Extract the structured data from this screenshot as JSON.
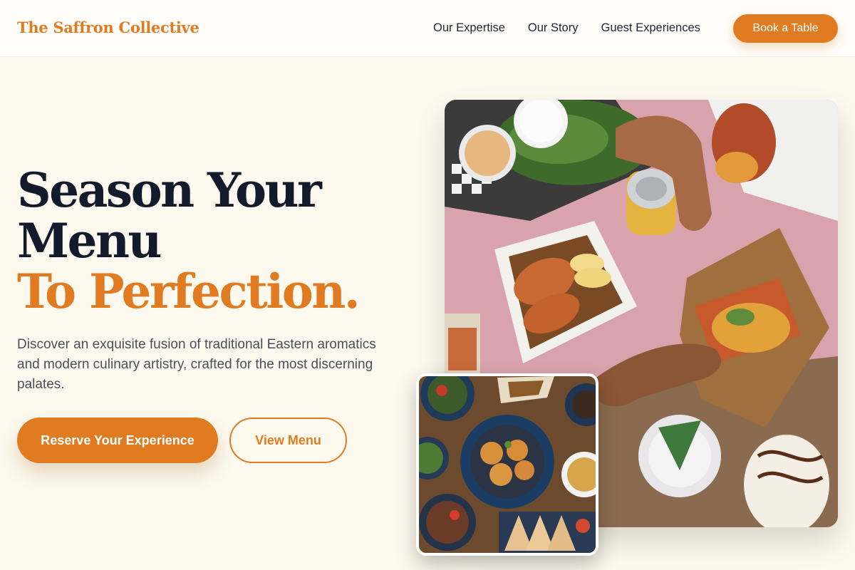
{
  "brand": {
    "name": "The Saffron Collective"
  },
  "nav": {
    "links": [
      "Our Expertise",
      "Our Story",
      "Guest Experiences"
    ],
    "cta": "Book a Table"
  },
  "hero": {
    "headline_line1": "Season Your",
    "headline_line2": "Menu",
    "headline_accent": "To Perfection.",
    "subtext": "Discover an exquisite fusion of traditional Eastern aromatics and modern culinary artistry, crafted for the most discerning palates.",
    "primary_cta": "Reserve Your Experience",
    "secondary_cta": "View Menu"
  },
  "colors": {
    "accent": "#e07b21",
    "background": "#fdf9ee",
    "heading": "#121a2c",
    "body_text": "#4a4f5c"
  },
  "images": {
    "main": "food-spread-photo",
    "small": "small-plates-photo"
  }
}
